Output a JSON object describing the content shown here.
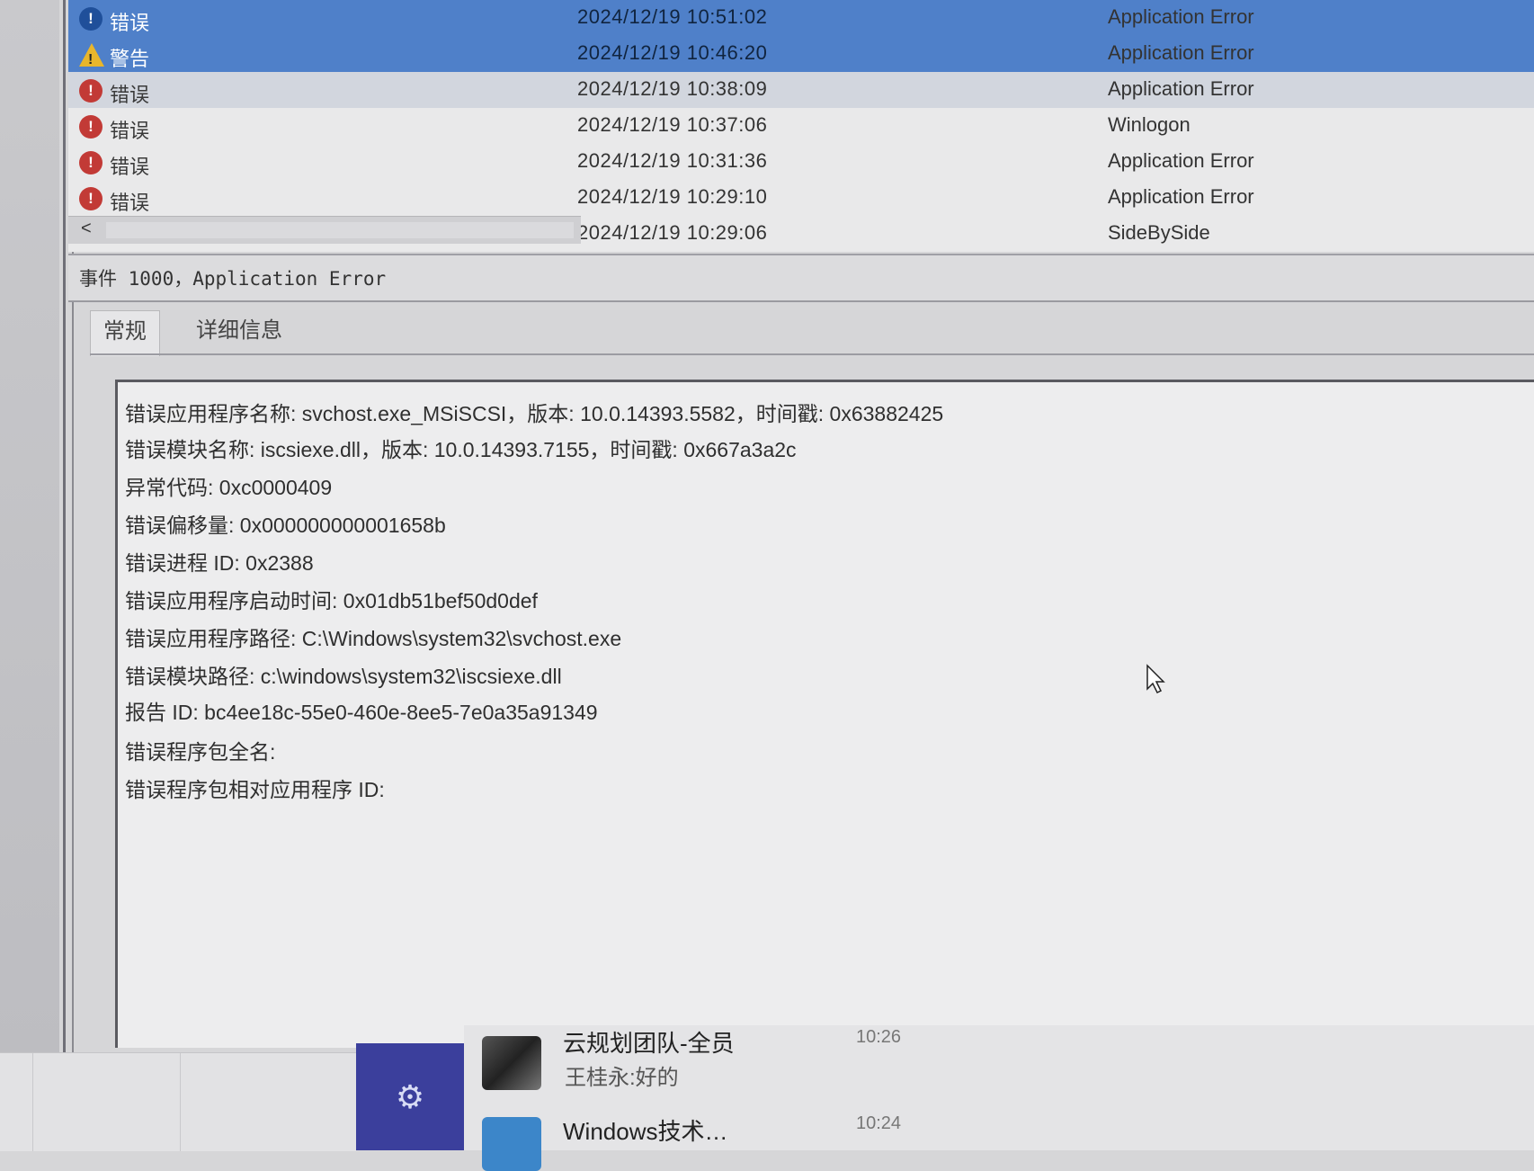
{
  "event_list": {
    "rows": [
      {
        "level": "错误",
        "level_type": "error",
        "date": "2024/12/19 10:51:02",
        "source": "Application Error",
        "state": "selected"
      },
      {
        "level": "警告",
        "level_type": "warning",
        "date": "2024/12/19 10:46:20",
        "source": "Application Error",
        "state": "selected"
      },
      {
        "level": "错误",
        "level_type": "error",
        "date": "2024/12/19 10:38:09",
        "source": "Application Error",
        "state": "selected"
      },
      {
        "level": "错误",
        "level_type": "error",
        "date": "2024/12/19 10:37:06",
        "source": "Winlogon",
        "state": "normal"
      },
      {
        "level": "错误",
        "level_type": "error",
        "date": "2024/12/19 10:31:36",
        "source": "Application Error",
        "state": "normal"
      },
      {
        "level": "错误",
        "level_type": "error",
        "date": "2024/12/19 10:29:10",
        "source": "Application Error",
        "state": "normal"
      },
      {
        "level": "",
        "level_type": "",
        "date": "2024/12/19 10:29:06",
        "source": "SideBySide",
        "state": "normal"
      }
    ],
    "scroll_left_arrow": "<"
  },
  "event_header": {
    "title": "事件 1000，Application Error"
  },
  "tabs": {
    "general": "常规",
    "details": "详细信息"
  },
  "detail": {
    "lines": [
      "错误应用程序名称: svchost.exe_MSiSCSI，版本: 10.0.14393.5582，时间戳: 0x63882425",
      "错误模块名称: iscsiexe.dll，版本: 10.0.14393.7155，时间戳: 0x667a3a2c",
      "异常代码: 0xc0000409",
      "错误偏移量: 0x000000000001658b",
      "错误进程 ID: 0x2388",
      "错误应用程序启动时间: 0x01db51bef50d0def",
      "错误应用程序路径: C:\\Windows\\system32\\svchost.exe",
      "错误模块路径: c:\\windows\\system32\\iscsiexe.dll",
      "报告 ID: bc4ee18c-55e0-460e-8ee5-7e0a35a91349",
      "错误程序包全名:",
      "错误程序包相对应用程序 ID:"
    ]
  },
  "notifications": [
    {
      "name": "云规划团队-全员",
      "message": "王桂永:好的",
      "time": "10:26",
      "avatar": "group-avatar"
    },
    {
      "name": "Windows技术…",
      "message": "",
      "time": "10:24",
      "avatar": "windows-avatar"
    }
  ],
  "icons": {
    "error": "error-icon",
    "warning": "warning-icon",
    "settings": "gear-icon",
    "cursor": "mouse-pointer-icon"
  },
  "colors": {
    "selection": "#4f80c9",
    "error": "#c23a36",
    "warning": "#e9b62b",
    "settings_tile": "#3b3f9c"
  }
}
